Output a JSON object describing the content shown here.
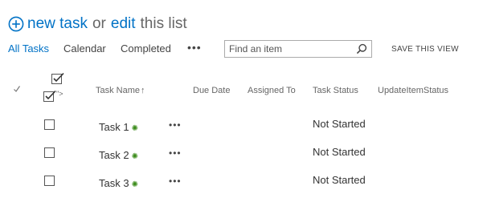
{
  "header": {
    "new_task": "new task",
    "or": "or",
    "edit": "edit",
    "this_list": "this list"
  },
  "views": {
    "tabs": [
      {
        "label": "All Tasks",
        "active": true
      },
      {
        "label": "Calendar",
        "active": false
      },
      {
        "label": "Completed",
        "active": false
      }
    ],
    "more": "•••"
  },
  "search": {
    "placeholder": "Find an item"
  },
  "save_view": "SAVE THIS VIEW",
  "artifact_text": "\">",
  "columns": [
    "Task Name",
    "Due Date",
    "Assigned To",
    "Task Status",
    "UpdateItemStatus"
  ],
  "sort_arrow": "↑",
  "rows": [
    {
      "title": "Task 1",
      "status": "Not Started",
      "is_new": true
    },
    {
      "title": "Task 2",
      "status": "Not Started",
      "is_new": true
    },
    {
      "title": "Task 3",
      "status": "Not Started",
      "is_new": true
    }
  ],
  "row_menu": "•••",
  "colors": {
    "accent": "#0072c6",
    "new_icon": "#3c8c1c"
  }
}
